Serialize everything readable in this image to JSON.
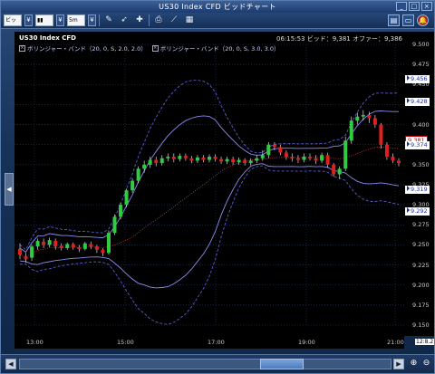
{
  "window": {
    "title": "US30 Index CFD ビッドチャート"
  },
  "toolbar": {
    "price_type": "ビッド",
    "timeframe": "5m",
    "icons": [
      "pen-icon",
      "cursor-icon",
      "crosshair-icon",
      "print-icon",
      "line-tool-icon",
      "grid-icon"
    ],
    "right_icons": [
      "layout-icon",
      "window-icon",
      "alert-icon"
    ]
  },
  "chart": {
    "symbol": "US30 Index CFD",
    "quote": "06:15:53  ビッド：9,381  オファー：9,386",
    "legend": [
      "ボリンジャー・バンド（20, 0, S, 2.0, 2.0）",
      "ボリンジャー・バンド（20, 0, S, 3.0, 3.0）"
    ],
    "last_price_label": "12:8.2"
  },
  "chart_data": {
    "type": "candlestick",
    "y_ticks": [
      9.5,
      9.475,
      9.45,
      9.425,
      9.4,
      9.375,
      9.35,
      9.325,
      9.3,
      9.275,
      9.25,
      9.225,
      9.2,
      9.175,
      9.15
    ],
    "y_tick_labels": [
      "9.500",
      "9.475",
      "9.450",
      "9.425",
      "9.400",
      "9.375",
      "9.350",
      "9.325",
      "9.300",
      "9.275",
      "9.250",
      "9.225",
      "9.200",
      "9.175",
      "9.150"
    ],
    "x_labels": [
      "13:00",
      "15:00",
      "17:00",
      "19:00",
      "21:00"
    ],
    "price_tags": [
      {
        "label": "9.456",
        "style": "blue"
      },
      {
        "label": "9.428",
        "style": "blue"
      },
      {
        "label": "9.381",
        "style": "red"
      },
      {
        "label": "9.374",
        "style": "blue"
      },
      {
        "label": "9.319",
        "style": "blue"
      },
      {
        "label": "9.292",
        "style": "blue"
      }
    ],
    "candles": [
      [
        9.245,
        9.238,
        9.252,
        9.232
      ],
      [
        9.236,
        9.232,
        9.24,
        9.228
      ],
      [
        9.234,
        9.248,
        9.25,
        9.23
      ],
      [
        9.248,
        9.255,
        9.258,
        9.244
      ],
      [
        9.254,
        9.25,
        9.258,
        9.246
      ],
      [
        9.25,
        9.256,
        9.259,
        9.247
      ],
      [
        9.255,
        9.248,
        9.258,
        9.244
      ],
      [
        9.249,
        9.246,
        9.252,
        9.243
      ],
      [
        9.246,
        9.251,
        9.253,
        9.244
      ],
      [
        9.251,
        9.247,
        9.253,
        9.244
      ],
      [
        9.247,
        9.245,
        9.25,
        9.241
      ],
      [
        9.245,
        9.252,
        9.254,
        9.243
      ],
      [
        9.251,
        9.248,
        9.254,
        9.245
      ],
      [
        9.248,
        9.244,
        9.25,
        9.24
      ],
      [
        9.244,
        9.24,
        9.246,
        9.236
      ],
      [
        9.24,
        9.265,
        9.268,
        9.238
      ],
      [
        9.265,
        9.285,
        9.288,
        9.262
      ],
      [
        9.285,
        9.3,
        9.303,
        9.282
      ],
      [
        9.3,
        9.318,
        9.32,
        9.297
      ],
      [
        9.318,
        9.33,
        9.333,
        9.315
      ],
      [
        9.33,
        9.345,
        9.348,
        9.327
      ],
      [
        9.345,
        9.35,
        9.355,
        9.34
      ],
      [
        9.35,
        9.356,
        9.36,
        9.346
      ],
      [
        9.356,
        9.352,
        9.36,
        9.348
      ],
      [
        9.352,
        9.358,
        9.362,
        9.349
      ],
      [
        9.358,
        9.36,
        9.364,
        9.354
      ],
      [
        9.36,
        9.357,
        9.364,
        9.353
      ],
      [
        9.357,
        9.361,
        9.364,
        9.354
      ],
      [
        9.361,
        9.358,
        9.364,
        9.355
      ],
      [
        9.358,
        9.355,
        9.361,
        9.352
      ],
      [
        9.355,
        9.359,
        9.362,
        9.352
      ],
      [
        9.359,
        9.356,
        9.362,
        9.353
      ],
      [
        9.356,
        9.36,
        9.363,
        9.353
      ],
      [
        9.36,
        9.357,
        9.363,
        9.354
      ],
      [
        9.357,
        9.354,
        9.36,
        9.351
      ],
      [
        9.354,
        9.357,
        9.36,
        9.351
      ],
      [
        9.357,
        9.353,
        9.36,
        9.35
      ],
      [
        9.353,
        9.356,
        9.359,
        9.35
      ],
      [
        9.356,
        9.352,
        9.358,
        9.349
      ],
      [
        9.352,
        9.355,
        9.358,
        9.349
      ],
      [
        9.355,
        9.358,
        9.362,
        9.352
      ],
      [
        9.358,
        9.362,
        9.368,
        9.355
      ],
      [
        9.362,
        9.375,
        9.378,
        9.358
      ],
      [
        9.375,
        9.372,
        9.378,
        9.368
      ],
      [
        9.372,
        9.365,
        9.375,
        9.362
      ],
      [
        9.365,
        9.36,
        9.368,
        9.356
      ],
      [
        9.36,
        9.358,
        9.364,
        9.354
      ],
      [
        9.358,
        9.356,
        9.362,
        9.352
      ],
      [
        9.356,
        9.36,
        9.364,
        9.353
      ],
      [
        9.36,
        9.358,
        9.364,
        9.355
      ],
      [
        9.358,
        9.355,
        9.362,
        9.351
      ],
      [
        9.355,
        9.362,
        9.365,
        9.352
      ],
      [
        9.362,
        9.35,
        9.365,
        9.346
      ],
      [
        9.35,
        9.338,
        9.352,
        9.335
      ],
      [
        9.338,
        9.345,
        9.348,
        9.332
      ],
      [
        9.345,
        9.38,
        9.385,
        9.342
      ],
      [
        9.38,
        9.405,
        9.41,
        9.376
      ],
      [
        9.405,
        9.41,
        9.415,
        9.4
      ],
      [
        9.41,
        9.412,
        9.418,
        9.405
      ],
      [
        9.412,
        9.408,
        9.416,
        9.402
      ],
      [
        9.408,
        9.4,
        9.412,
        9.396
      ],
      [
        9.4,
        9.375,
        9.402,
        9.37
      ],
      [
        9.375,
        9.36,
        9.378,
        9.356
      ],
      [
        9.36,
        9.355,
        9.364,
        9.352
      ],
      [
        9.355,
        9.352,
        9.358,
        9.348
      ]
    ]
  }
}
